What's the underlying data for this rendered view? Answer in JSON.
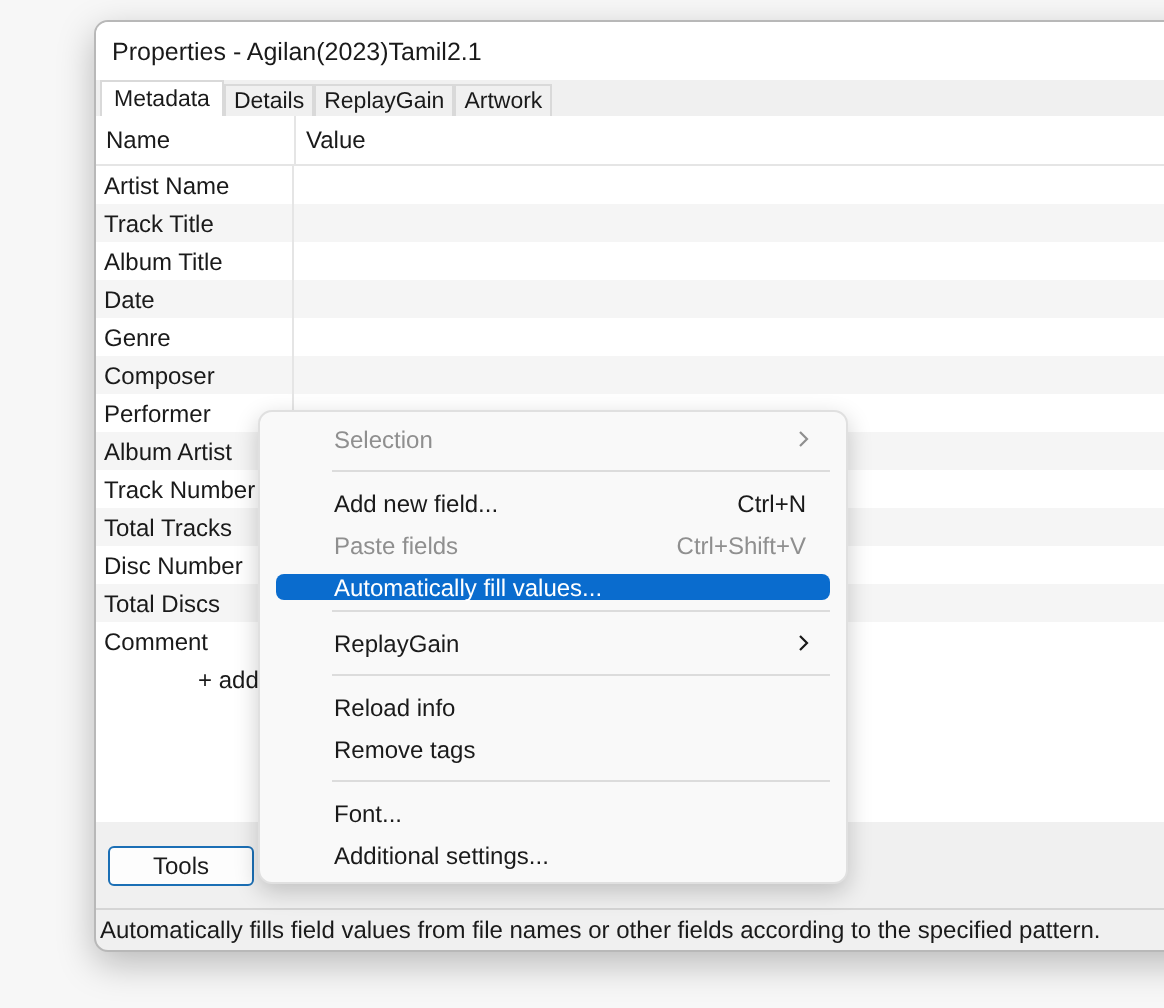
{
  "window": {
    "title": "Properties - Agilan(2023)Tamil2.1"
  },
  "tabs": [
    {
      "label": "Metadata",
      "selected": true
    },
    {
      "label": "Details",
      "selected": false
    },
    {
      "label": "ReplayGain",
      "selected": false
    },
    {
      "label": "Artwork",
      "selected": false
    }
  ],
  "table": {
    "columns": [
      "Name",
      "Value"
    ],
    "rows": [
      {
        "name": "Artist Name"
      },
      {
        "name": "Track Title"
      },
      {
        "name": "Album Title"
      },
      {
        "name": "Date"
      },
      {
        "name": "Genre"
      },
      {
        "name": "Composer"
      },
      {
        "name": "Performer"
      },
      {
        "name": "Album Artist"
      },
      {
        "name": "Track Number"
      },
      {
        "name": "Total Tracks"
      },
      {
        "name": "Disc Number"
      },
      {
        "name": "Total Discs"
      },
      {
        "name": "Comment"
      }
    ],
    "add_row": "+ add"
  },
  "tools_button": "Tools",
  "context_menu": [
    {
      "kind": "item",
      "label": "Selection",
      "disabled": true,
      "submenu": true,
      "selected": false
    },
    {
      "kind": "separator"
    },
    {
      "kind": "item",
      "label": "Add new field...",
      "shortcut": "Ctrl+N",
      "disabled": false,
      "submenu": false,
      "selected": false
    },
    {
      "kind": "item",
      "label": "Paste fields",
      "shortcut": "Ctrl+Shift+V",
      "disabled": true,
      "submenu": false,
      "selected": false
    },
    {
      "kind": "item",
      "label": "Automatically fill values...",
      "disabled": false,
      "submenu": false,
      "selected": true
    },
    {
      "kind": "separator"
    },
    {
      "kind": "item",
      "label": "ReplayGain",
      "disabled": false,
      "submenu": true,
      "selected": false
    },
    {
      "kind": "separator"
    },
    {
      "kind": "item",
      "label": "Reload info",
      "disabled": false,
      "submenu": false,
      "selected": false
    },
    {
      "kind": "item",
      "label": "Remove tags",
      "disabled": false,
      "submenu": false,
      "selected": false
    },
    {
      "kind": "separator"
    },
    {
      "kind": "item",
      "label": "Font...",
      "disabled": false,
      "submenu": false,
      "selected": false
    },
    {
      "kind": "item",
      "label": "Additional settings...",
      "disabled": false,
      "submenu": false,
      "selected": false
    }
  ],
  "status_bar": "Automatically fills field values from file names or other fields according to the specified pattern."
}
